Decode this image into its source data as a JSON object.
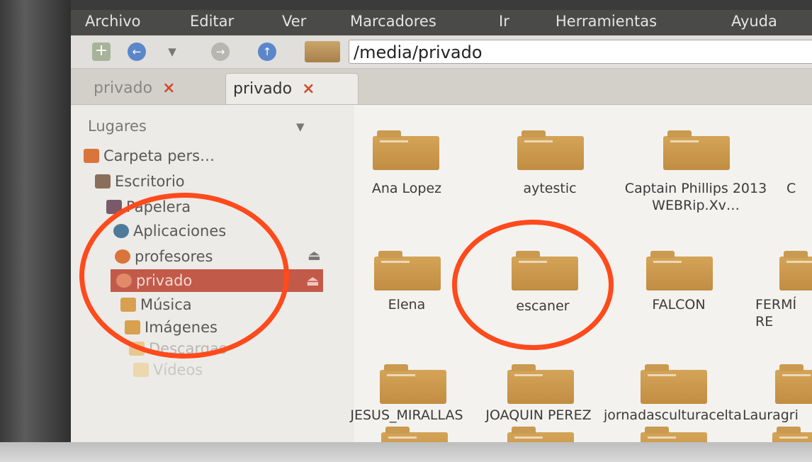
{
  "menu": [
    "Archivo",
    "Editar",
    "Ver",
    "Marcadores",
    "Ir",
    "Herramientas",
    "Ayuda"
  ],
  "location": {
    "path": "/media/privado"
  },
  "tabs": [
    {
      "label": "privado",
      "close": "×",
      "active": false
    },
    {
      "label": "privado",
      "close": "×",
      "active": true
    }
  ],
  "sidebar": {
    "header": "Lugares",
    "items": [
      {
        "label": "Carpeta pers…",
        "icon": "home-icon"
      },
      {
        "label": "Escritorio",
        "icon": "desktop-icon"
      },
      {
        "label": "Papelera",
        "icon": "trash-icon"
      },
      {
        "label": "Aplicaciones",
        "icon": "applications-icon"
      },
      {
        "label": "profesores",
        "icon": "network-drive-icon"
      },
      {
        "label": "privado",
        "icon": "network-drive-icon",
        "selected": true
      },
      {
        "label": "Música",
        "icon": "music-icon"
      },
      {
        "label": "Imágenes",
        "icon": "pictures-icon"
      },
      {
        "label": "Descargas",
        "icon": "downloads-icon"
      },
      {
        "label": "Vídeos",
        "icon": "videos-icon"
      }
    ]
  },
  "folders": {
    "row1": [
      "Ana Lopez",
      "aytestic",
      "Captain Phillips 2013 WEBRip.Xv…",
      "C"
    ],
    "row2": [
      "Elena",
      "escaner",
      "FALCON",
      "FERMÍ RE"
    ],
    "row3": [
      "JESUS_MIRALLAS",
      "JOAQUIN PEREZ",
      "jornadasculturacelta",
      "Lauragri"
    ]
  },
  "colors": {
    "accent_selected": "#c25a4a",
    "folder": "#c99a50",
    "annotation_circle": "#ff4a1c"
  }
}
